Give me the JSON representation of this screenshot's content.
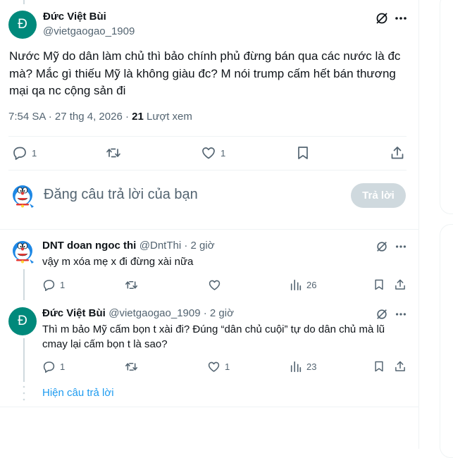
{
  "main_post": {
    "avatar_letter": "Đ",
    "author": "Đức Việt Bùi",
    "handle": "@vietgaogao_1909",
    "text": "Nước Mỹ do dân làm chủ thì bảo chính phủ đừng bán qua các nước là đc mà? Mắc gì thiếu Mỹ là không giàu đc? M nói trump cấm hết bán thương mại qa nc cộng sản đi",
    "time": "7:54 SA · 27 thg 4, 2026 · ",
    "views_count": "21",
    "views_label": " Lượt xem",
    "replies": "1",
    "likes": "1"
  },
  "compose": {
    "placeholder": "Đăng câu trả lời của bạn",
    "button": "Trả lời"
  },
  "replies": [
    {
      "author": "DNT doan ngoc thi",
      "handle": "@DntThi · 2 giờ",
      "text": "vậy m xóa mẹ x đi đừng xài nữa",
      "replies": "1",
      "views": "26"
    },
    {
      "avatar_letter": "Đ",
      "author": "Đức Việt Bùi",
      "handle": "@vietgaogao_1909 · 2 giờ",
      "text": "Thì m bảo Mỹ cấm bọn t xài đi? Đúng “dân chủ cuội” tự do dân chủ mà lũ cmay lại cấm bọn t là sao?",
      "replies": "1",
      "likes": "1",
      "views": "23"
    }
  ],
  "show_replies": "Hiện câu trả lời",
  "colors": {
    "accent": "#1d9bf0",
    "avatar": "#00897b",
    "muted": "#536471"
  },
  "icons": [
    "grok-icon",
    "more-icon",
    "reply-icon",
    "retweet-icon",
    "like-icon",
    "bookmark-icon",
    "share-icon",
    "views-icon"
  ]
}
